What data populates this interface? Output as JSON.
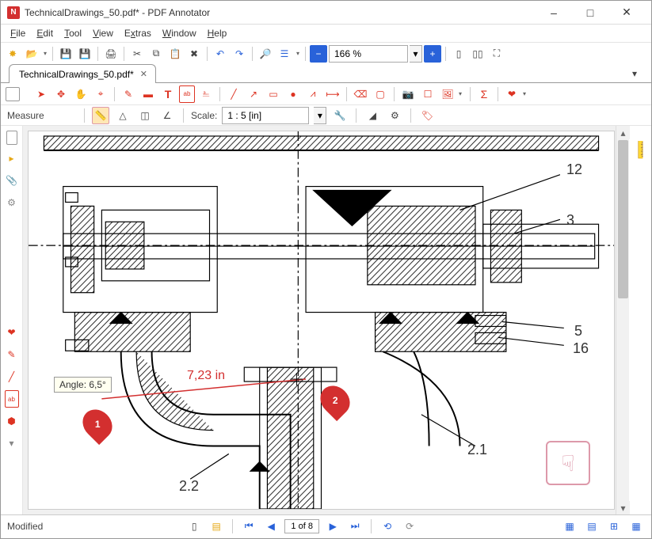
{
  "window": {
    "title": "TechnicalDrawings_50.pdf* - PDF Annotator"
  },
  "menu": {
    "file": "File",
    "edit": "Edit",
    "tool": "Tool",
    "view": "View",
    "extras": "Extras",
    "window": "Window",
    "help": "Help"
  },
  "toolbar": {
    "zoom_value": "166 %"
  },
  "tab": {
    "label": "TechnicalDrawings_50.pdf*"
  },
  "measure": {
    "label": "Measure",
    "scale_label": "Scale:",
    "scale_value": "1 : 5 [in]"
  },
  "drawing": {
    "dim_value": "7,23 in",
    "tooltip": "Angle: 6,5°",
    "pin1": "1",
    "pin2": "2",
    "callouts": {
      "c12": "12",
      "c3": "3",
      "c5": "5",
      "c16": "16",
      "c2_1": "2.1",
      "c2_2": "2.2"
    }
  },
  "status": {
    "modified": "Modified",
    "page": "1 of 8"
  }
}
